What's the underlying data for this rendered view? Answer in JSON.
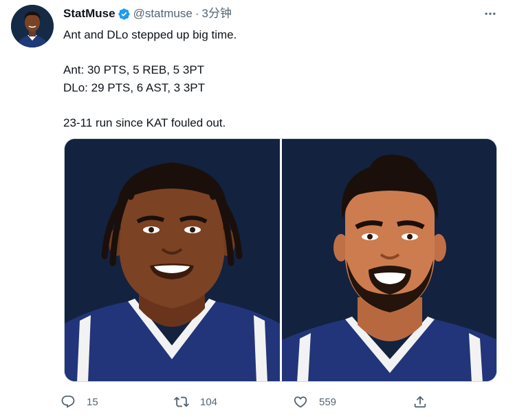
{
  "author": {
    "display_name": "StatMuse",
    "handle": "@statmuse",
    "separator": "·",
    "time": "3分钟",
    "verified": true
  },
  "tweet": {
    "text": "Ant and DLo stepped up big time.\n\nAnt: 30 PTS, 5 REB, 5 3PT\nDLo: 29 PTS, 6 AST, 3 3PT\n\n23-11 run since KAT fouled out."
  },
  "media": {
    "images": [
      {
        "subject": "player-illustration-ant"
      },
      {
        "subject": "player-illustration-dlo"
      }
    ],
    "background_color": "#13223f"
  },
  "actions": {
    "reply_count": "15",
    "retweet_count": "104",
    "like_count": "559"
  },
  "colors": {
    "verified": "#1d9bf0",
    "muted": "#536471",
    "text": "#0f1419"
  }
}
